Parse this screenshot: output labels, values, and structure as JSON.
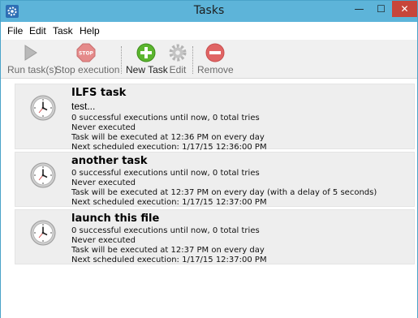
{
  "window": {
    "title": "Tasks"
  },
  "titlebar": {
    "minimize": "—",
    "maximize": "☐",
    "close": "✕"
  },
  "menu": {
    "file": "File",
    "edit": "Edit",
    "task": "Task",
    "help": "Help"
  },
  "toolbar": {
    "run": "Run task(s)",
    "stop": "Stop execution",
    "new": "New Task",
    "edit": "Edit",
    "remove": "Remove"
  },
  "colors": {
    "titlebar": "#5db4d9",
    "close": "#c7463b",
    "item_bg": "#eeeeee",
    "new_green": "#5bb52e",
    "remove_red": "#e06464"
  },
  "tasks": [
    {
      "name": "ILFS task",
      "description": "test...",
      "stats": "0 successful executions until now, 0 total tries",
      "last": "Never executed",
      "schedule": "Task will be executed at 12:36 PM on every day",
      "next": "Next scheduled execution: 1/17/15 12:36:00 PM"
    },
    {
      "name": "another task",
      "stats": "0 successful executions until now, 0 total tries",
      "last": "Never executed",
      "schedule": "Task will be executed at 12:37 PM on every day (with a delay of 5 seconds)",
      "next": "Next scheduled execution: 1/17/15 12:37:00 PM"
    },
    {
      "name": "launch this file",
      "stats": "0 successful executions until now, 0 total tries",
      "last": "Never executed",
      "schedule": "Task will be executed at 12:37 PM on every day",
      "next": "Next scheduled execution: 1/17/15 12:37:00 PM"
    }
  ]
}
